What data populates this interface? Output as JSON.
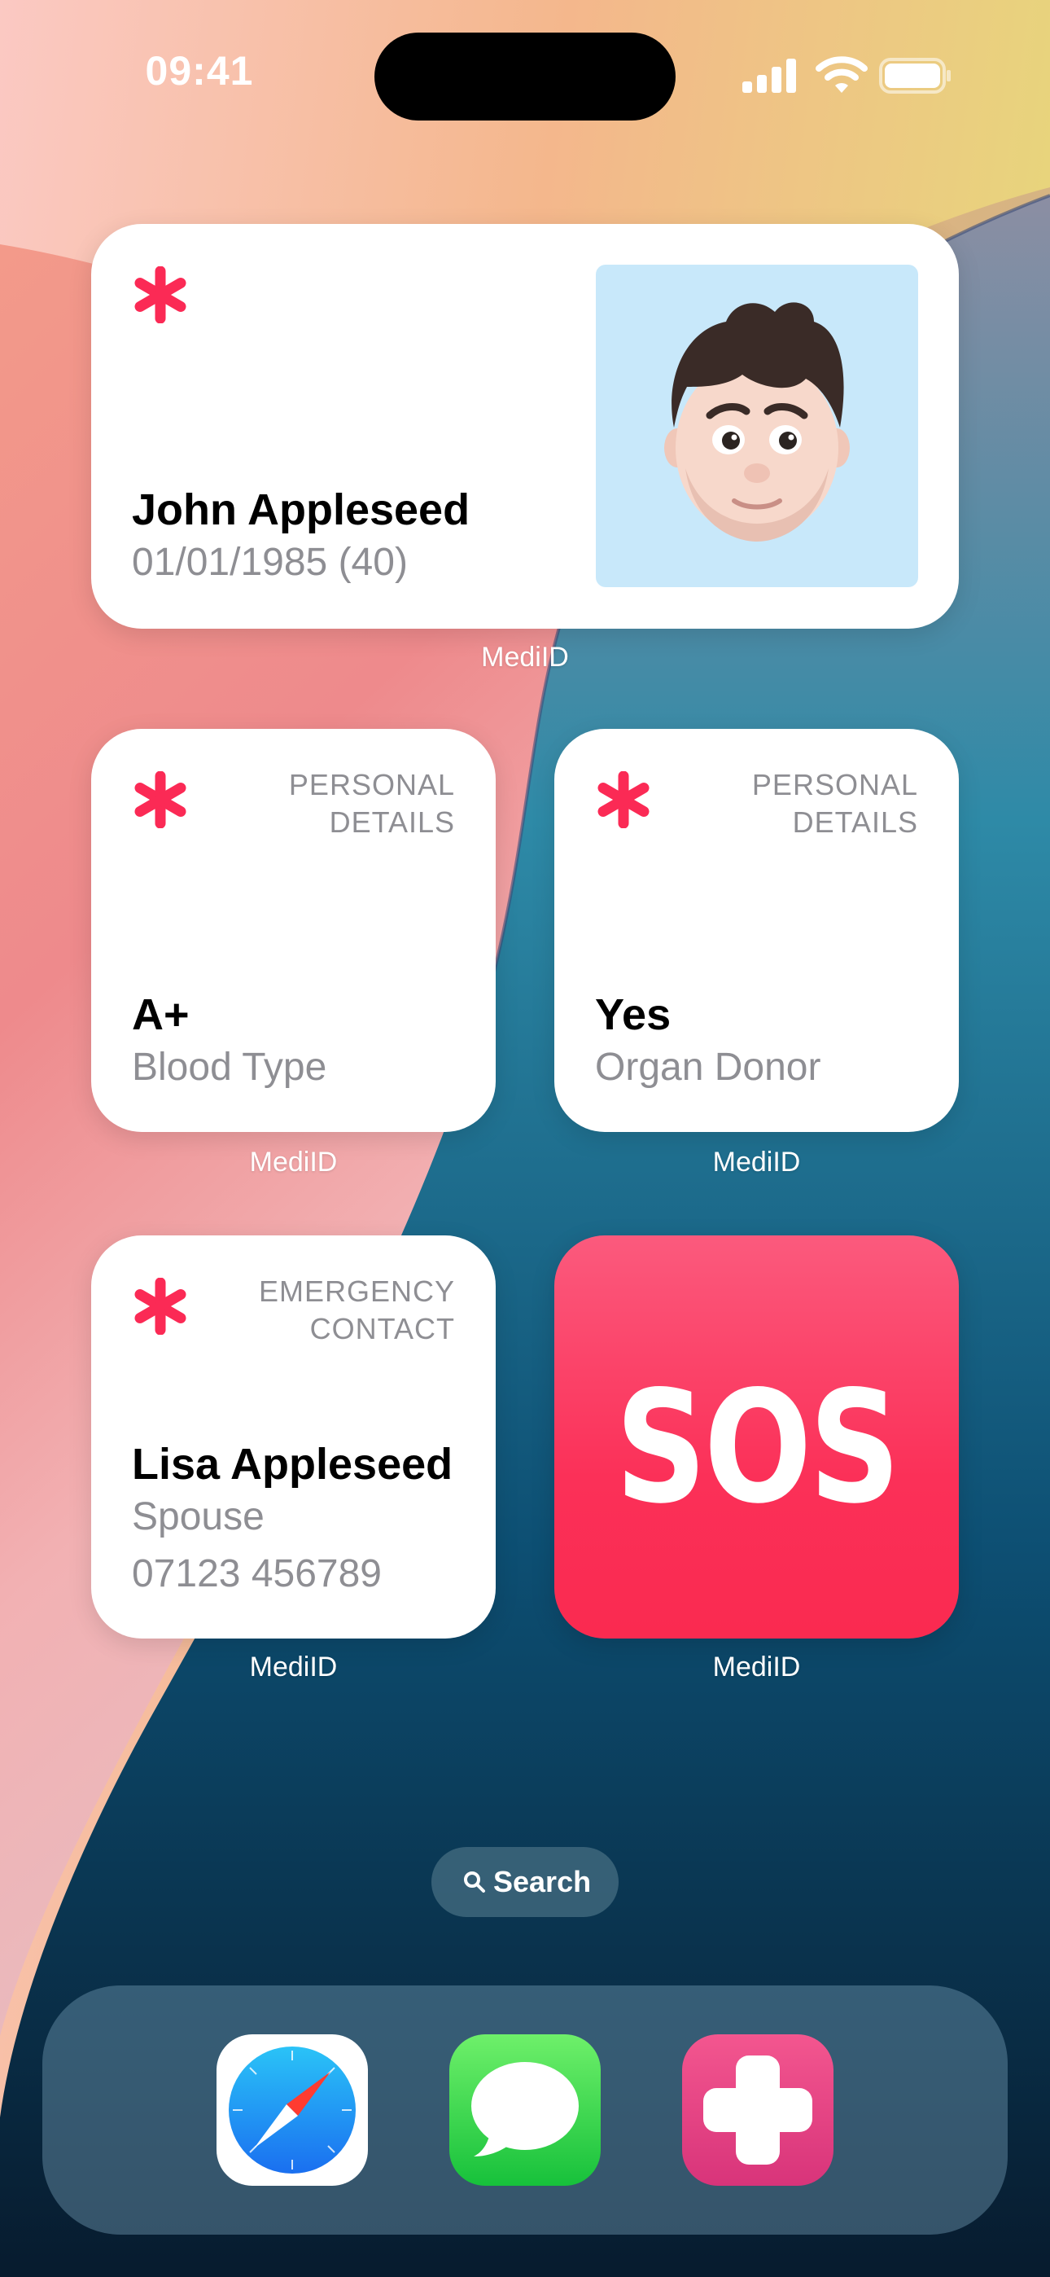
{
  "status_bar": {
    "time": "09:41"
  },
  "widgets": {
    "profile": {
      "name": "John Appleseed",
      "dob": "01/01/1985 (40)",
      "app_label": "MediID"
    },
    "blood_type": {
      "category": "PERSONAL DETAILS",
      "value": "A+",
      "caption": "Blood Type",
      "app_label": "MediID"
    },
    "organ_donor": {
      "category": "PERSONAL DETAILS",
      "value": "Yes",
      "caption": "Organ Donor",
      "app_label": "MediID"
    },
    "emergency_contact": {
      "category": "EMERGENCY CONTACT",
      "name": "Lisa Appleseed",
      "relationship": "Spouse",
      "phone": "07123 456789",
      "app_label": "MediID"
    },
    "sos": {
      "label": "SOS",
      "app_label": "MediID"
    }
  },
  "search": {
    "label": "Search"
  },
  "dock": {
    "apps": [
      {
        "icon": "safari-icon"
      },
      {
        "icon": "messages-icon"
      },
      {
        "icon": "mediid-cross-icon"
      }
    ]
  },
  "colors": {
    "accent_red": "#fb2a55",
    "sos_top": "#fb5a7d",
    "sos_bottom": "#fa2a50"
  }
}
